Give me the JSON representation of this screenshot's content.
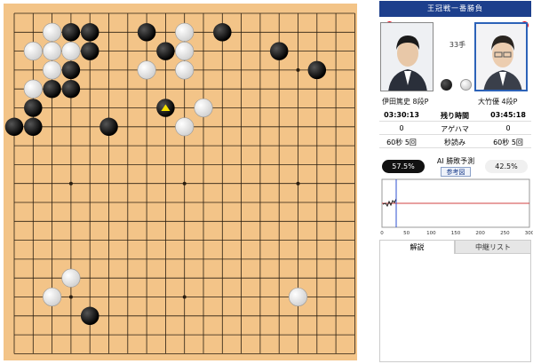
{
  "header": {
    "title": "王冠戦一番勝負"
  },
  "move_count": "33手",
  "players": {
    "black": {
      "name": "伊田篤史 8段P",
      "time_left": "03:30:13",
      "agehama": "0",
      "byoyomi": "60秒 5回",
      "win_pct": "57.5%"
    },
    "white": {
      "name": "大竹優 4段P",
      "time_left": "03:45:18",
      "agehama": "0",
      "byoyomi": "60秒 5回",
      "win_pct": "42.5%"
    }
  },
  "table_labels": {
    "time": "残り時間",
    "agehama": "アゲハマ",
    "byoyomi": "秒読み"
  },
  "ai": {
    "title": "AI 勝敗予測",
    "button": "参考図"
  },
  "graph": {
    "x_ticks": [
      "0",
      "50",
      "100",
      "150",
      "200",
      "250",
      "300"
    ],
    "current_move": 33
  },
  "tabs": {
    "commentary": "解説",
    "relay_list": "中継リスト"
  },
  "colors": {
    "board": "#f3c488",
    "header": "#1d3f8c",
    "flag": "#e60012",
    "last_move_marker": "#f5e000"
  },
  "board": {
    "size": 19,
    "black": [
      [
        3,
        1
      ],
      [
        4,
        1
      ],
      [
        7,
        1
      ],
      [
        11,
        1
      ],
      [
        4,
        2
      ],
      [
        8,
        2
      ],
      [
        14,
        2
      ],
      [
        3,
        3
      ],
      [
        16,
        3
      ],
      [
        2,
        4
      ],
      [
        3,
        4
      ],
      [
        1,
        5
      ],
      [
        8,
        5
      ],
      [
        0,
        6
      ],
      [
        1,
        6
      ],
      [
        5,
        6
      ],
      [
        4,
        16
      ]
    ],
    "white": [
      [
        2,
        1
      ],
      [
        9,
        1
      ],
      [
        1,
        2
      ],
      [
        2,
        2
      ],
      [
        3,
        2
      ],
      [
        9,
        2
      ],
      [
        2,
        3
      ],
      [
        7,
        3
      ],
      [
        9,
        3
      ],
      [
        1,
        4
      ],
      [
        10,
        5
      ],
      [
        9,
        6
      ],
      [
        3,
        14
      ],
      [
        2,
        15
      ],
      [
        15,
        15
      ]
    ],
    "last_move": [
      8,
      5
    ]
  }
}
